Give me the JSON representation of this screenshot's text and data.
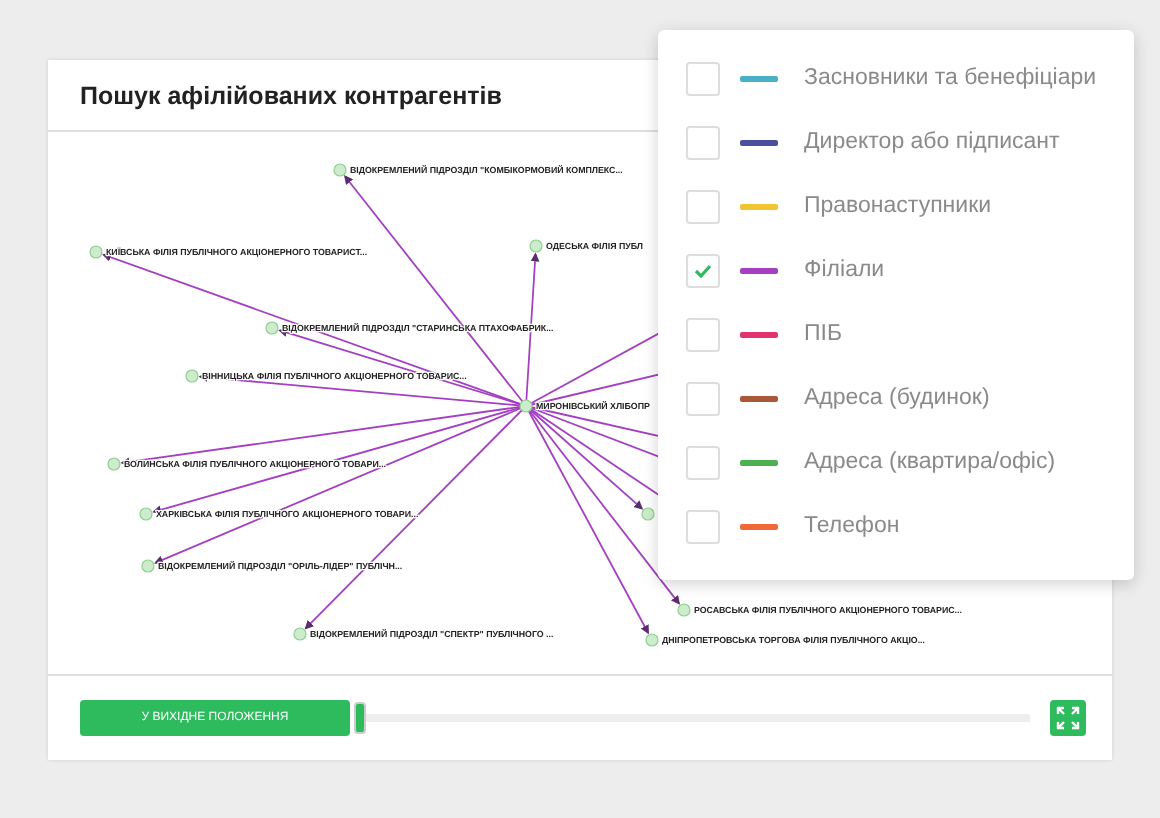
{
  "title": "Пошук афілійованих контрагентів",
  "graph": {
    "center": {
      "label": "МИРОНІВСЬКИЙ ХЛІБОПР"
    },
    "nodes": [
      {
        "label": "ВІДОКРЕМЛЕНИЙ ПІДРОЗДІЛ \"КОМБІКОРМОВИЙ КОМПЛЕКС..."
      },
      {
        "label": "КИЇВСЬКА ФІЛІЯ ПУБЛІЧНОГО АКЦІОНЕРНОГО ТОВАРИСТ..."
      },
      {
        "label": "ОДЕСЬКА ФІЛІЯ ПУБЛ"
      },
      {
        "label": "ВІДОКРЕМЛЕНИЙ ПІДРОЗДІЛ \"СТАРИНСЬКА ПТАХОФАБРИК..."
      },
      {
        "label": "ВІННИЦЬКА ФІЛІЯ ПУБЛІЧНОГО АКЦІОНЕРНОГО ТОВАРИС..."
      },
      {
        "label": "ВОЛИНСЬКА ФІЛІЯ ПУБЛІЧНОГО АКЦІОНЕРНОГО ТОВАРИ..."
      },
      {
        "label": "ХАРКІВСЬКА ФІЛІЯ ПУБЛІЧНОГО АКЦІОНЕРНОГО ТОВАРИ..."
      },
      {
        "label": "ВІДОКРЕМЛЕНИЙ ПІДРОЗДІЛ \"ОРІЛЬ-ЛІДЕР\" ПУБЛІЧН..."
      },
      {
        "label": "ВІДОКРЕМЛЕНИЙ ПІДРОЗДІЛ \"СПЕКТР\" ПУБЛІЧНОГО ..."
      },
      {
        "label": "РОСАВСЬКА ФІЛІЯ ПУБЛІЧНОГО АКЦІОНЕРНОГО ТОВАРИС..."
      },
      {
        "label": "ДНІПРОПЕТРОВСЬКА ТОРГОВА ФІЛІЯ ПУБЛІЧНОГО АКЦІО..."
      }
    ]
  },
  "legend": [
    {
      "label": "Засновники та бенефіціари",
      "color": "#4ab0c8",
      "checked": false
    },
    {
      "label": "Директор або підписант",
      "color": "#4b4f9e",
      "checked": false
    },
    {
      "label": "Правонаступники",
      "color": "#f2c530",
      "checked": false
    },
    {
      "label": "Філіали",
      "color": "#a43fc2",
      "checked": true
    },
    {
      "label": "ПІБ",
      "color": "#e3336f",
      "checked": false
    },
    {
      "label": "Адреса (будинок)",
      "color": "#a9583a",
      "checked": false
    },
    {
      "label": "Адреса (квартира/офіс)",
      "color": "#4caf50",
      "checked": false
    },
    {
      "label": "Телефон",
      "color": "#f0683a",
      "checked": false
    }
  ],
  "reset_button": {
    "label": "У ВИХІДНЕ ПОЛОЖЕННЯ"
  },
  "zoom_slider": {
    "level": 0
  }
}
